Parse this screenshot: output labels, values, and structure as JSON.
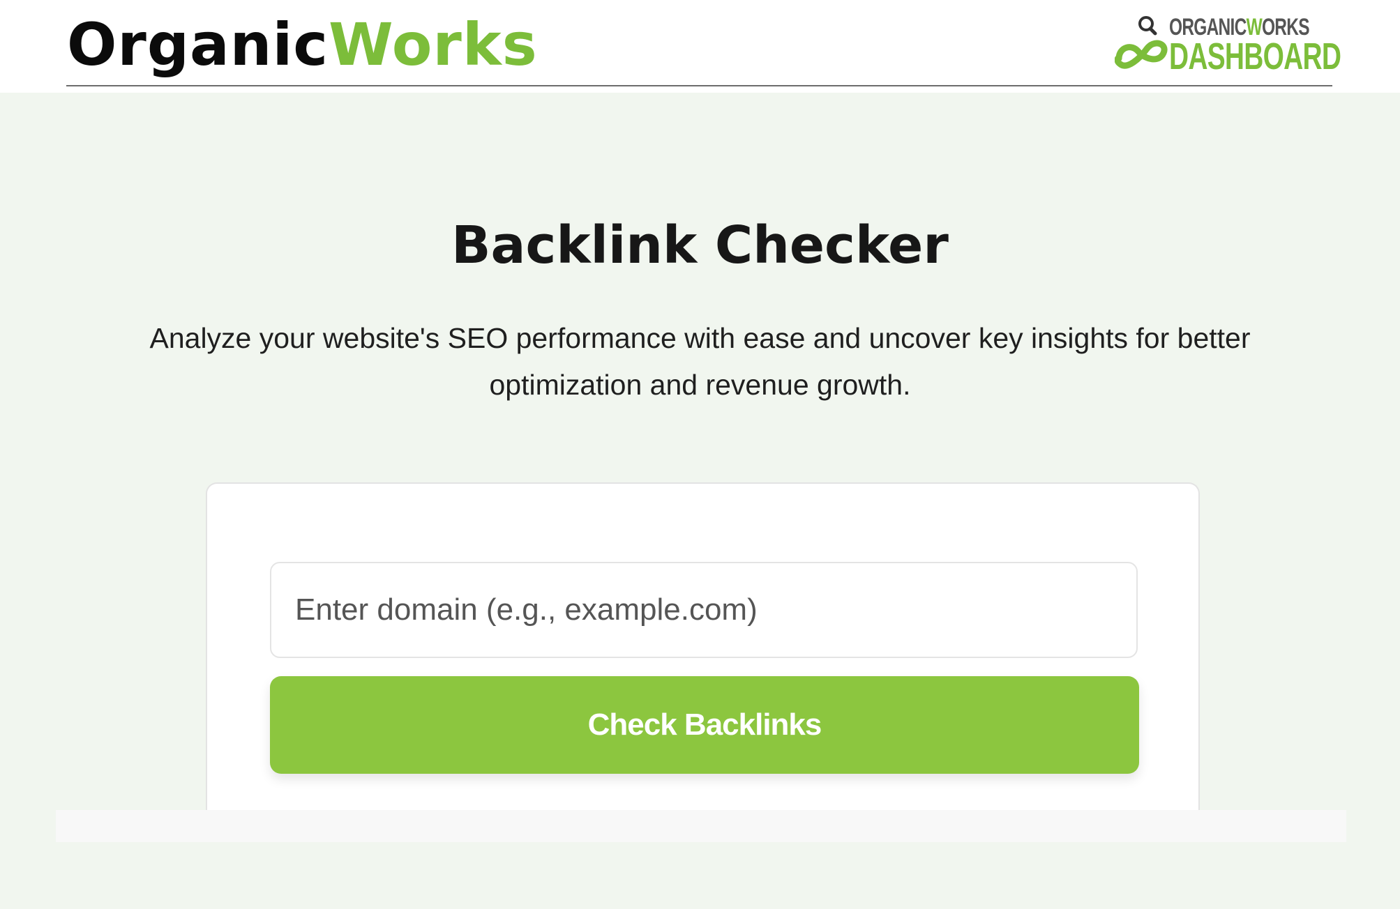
{
  "header": {
    "brand_part1": "Organic",
    "brand_part2": "Works",
    "dashboard_logo": {
      "line1_part1": "ORGANIC",
      "line1_part2": "W",
      "line1_part3": "ORKS",
      "line2": "DASHBOARD",
      "icon": "infinity-magnifier-icon"
    }
  },
  "main": {
    "title": "Backlink Checker",
    "subtitle": "Analyze your website's SEO performance with ease and  uncover key insights for better optimization and revenue growth."
  },
  "form": {
    "domain_placeholder": "Enter domain (e.g., example.com)",
    "domain_value": "",
    "submit_label": "Check Backlinks"
  },
  "colors": {
    "brand_green": "#7cbd3a",
    "button_green": "#8cc63f",
    "page_background": "#f1f6ef"
  }
}
